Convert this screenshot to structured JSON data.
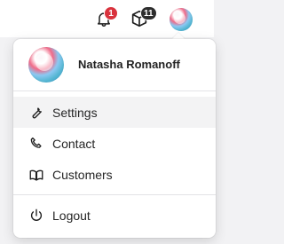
{
  "header": {
    "notifications": {
      "count": "1",
      "badge_color": "#d9323d"
    },
    "packages": {
      "count": "11",
      "badge_color": "#2d2d2d"
    }
  },
  "user": {
    "name": "Natasha Romanoff"
  },
  "menu": {
    "items": [
      {
        "label": "Settings",
        "icon": "wrench-icon"
      },
      {
        "label": "Contact",
        "icon": "phone-icon"
      },
      {
        "label": "Customers",
        "icon": "book-icon"
      }
    ],
    "logout": {
      "label": "Logout",
      "icon": "power-icon"
    }
  }
}
